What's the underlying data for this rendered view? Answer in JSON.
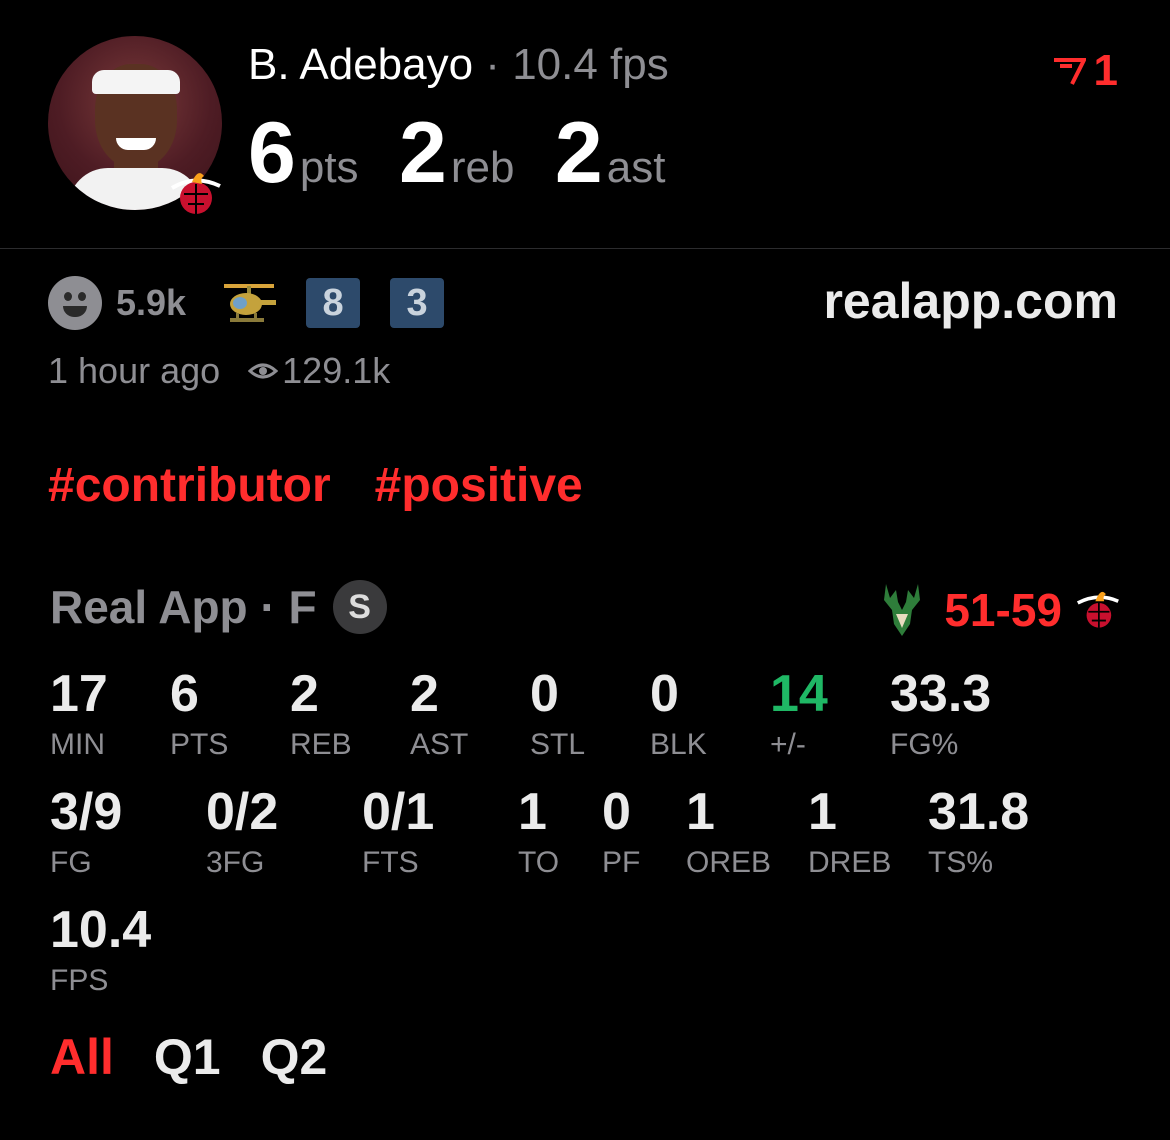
{
  "player": {
    "name": "B. Adebayo",
    "separator": " · ",
    "fps_summary": "10.4 fps",
    "rank": "1",
    "big_stats": [
      {
        "value": "6",
        "label": "pts"
      },
      {
        "value": "2",
        "label": "reb"
      },
      {
        "value": "2",
        "label": "ast"
      }
    ]
  },
  "meta": {
    "reactions": "5.9k",
    "badge_1": "8",
    "badge_2": "3",
    "site": "realapp.com",
    "time_ago": "1 hour ago",
    "views": "129.1k"
  },
  "tags": [
    "#contributor",
    "#positive"
  ],
  "game": {
    "label": "Real App · F",
    "status_badge": "S",
    "score": "51-59",
    "colors": {
      "accent": "#ff2d2d",
      "positive": "#1fb865",
      "muted": "#8e8e93"
    }
  },
  "stats_row1": [
    {
      "v": "17",
      "k": "MIN"
    },
    {
      "v": "6",
      "k": "PTS"
    },
    {
      "v": "2",
      "k": "REB"
    },
    {
      "v": "2",
      "k": "AST"
    },
    {
      "v": "0",
      "k": "STL"
    },
    {
      "v": "0",
      "k": "BLK"
    },
    {
      "v": "14",
      "k": "+/-"
    },
    {
      "v": "33.3",
      "k": "FG%"
    }
  ],
  "stats_row2": [
    {
      "v": "3/9",
      "k": "FG"
    },
    {
      "v": "0/2",
      "k": "3FG"
    },
    {
      "v": "0/1",
      "k": "FTS"
    },
    {
      "v": "1",
      "k": "TO"
    },
    {
      "v": "0",
      "k": "PF"
    },
    {
      "v": "1",
      "k": "OREB"
    },
    {
      "v": "1",
      "k": "DREB"
    },
    {
      "v": "31.8",
      "k": "TS%"
    }
  ],
  "stats_row3": [
    {
      "v": "10.4",
      "k": "FPS"
    }
  ],
  "period_tabs": [
    "All",
    "Q1",
    "Q2"
  ]
}
